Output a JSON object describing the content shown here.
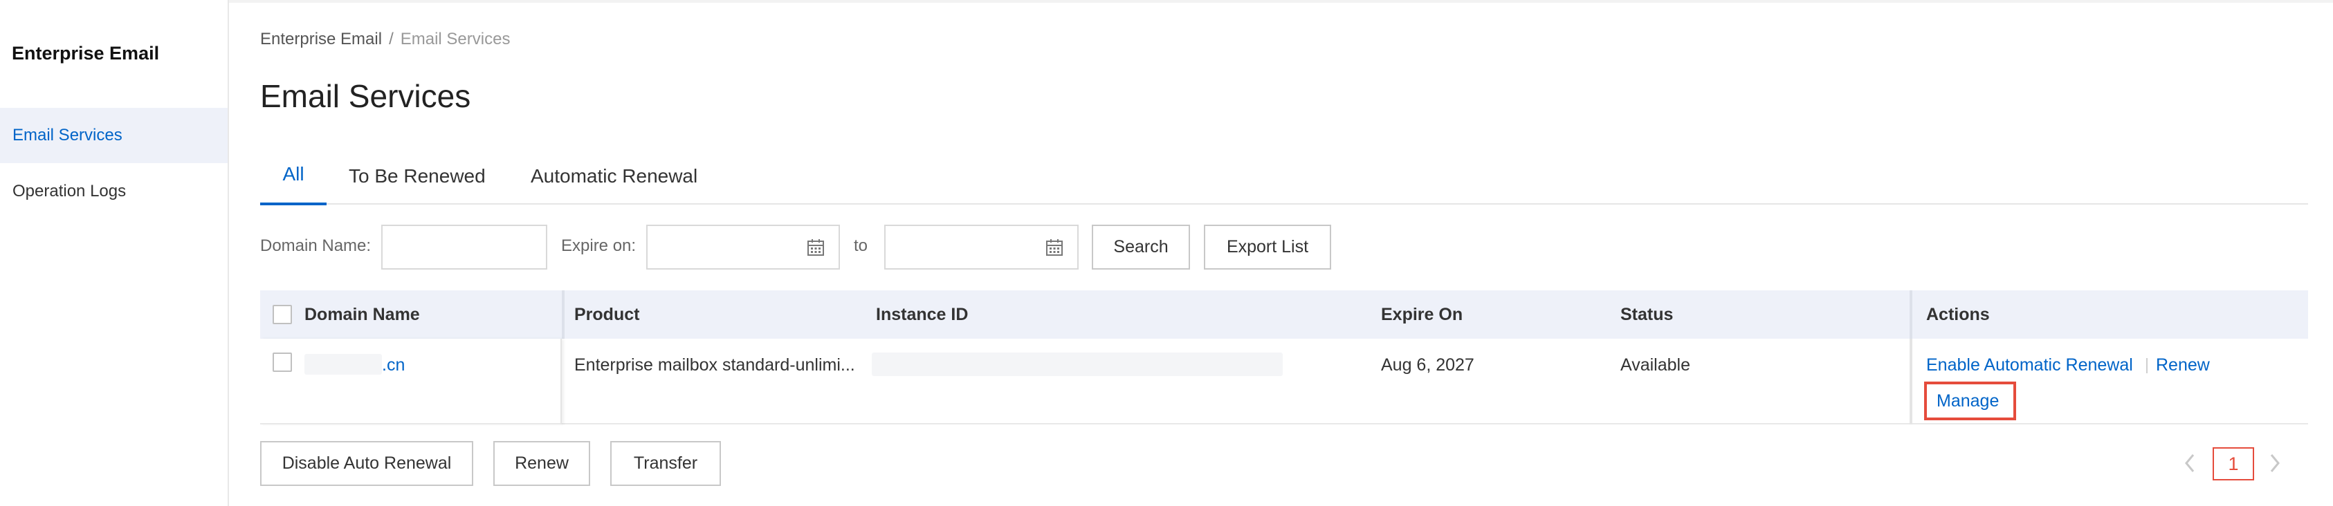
{
  "sidebar": {
    "title": "Enterprise Email",
    "items": [
      {
        "label": "Email Services",
        "active": true
      },
      {
        "label": "Operation Logs",
        "active": false
      }
    ]
  },
  "breadcrumb": {
    "root": "Enterprise Email",
    "separator": "/",
    "current": "Email Services"
  },
  "page_title": "Email Services",
  "tabs": [
    {
      "label": "All",
      "active": true
    },
    {
      "label": "To Be Renewed",
      "active": false
    },
    {
      "label": "Automatic Renewal",
      "active": false
    }
  ],
  "filter": {
    "domain_label": "Domain Name:",
    "domain_value": "",
    "expire_label": "Expire on:",
    "to_label": "to",
    "search_label": "Search",
    "export_label": "Export List"
  },
  "table": {
    "columns": [
      "Domain Name",
      "Product",
      "Instance ID",
      "Expire On",
      "Status",
      "Actions"
    ],
    "rows": [
      {
        "domain": ".cn",
        "product": "Enterprise mailbox standard-unlimi...",
        "instance_id": "",
        "expire_on": "Aug 6, 2027",
        "status": "Available",
        "actions": {
          "enable_auto_renewal": "Enable Automatic Renewal",
          "renew": "Renew",
          "manage": "Manage"
        }
      }
    ]
  },
  "bulk_actions": {
    "disable_auto_renewal": "Disable Auto Renewal",
    "renew": "Renew",
    "transfer": "Transfer"
  },
  "pagination": {
    "current_page": "1"
  },
  "colors": {
    "accent": "#0064c8",
    "highlight": "#e54c3c",
    "header_bg": "#eef1f9"
  }
}
